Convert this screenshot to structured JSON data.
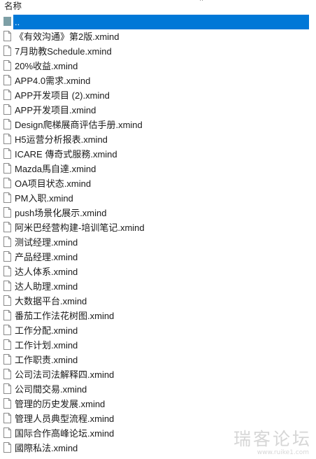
{
  "header": {
    "column_label": "名称",
    "sort_indicator": "^"
  },
  "colors": {
    "selection": "#0078d7",
    "folder_icon": "#7d9fa6",
    "file_icon_border": "#8a8a8a"
  },
  "files": [
    {
      "name": "..",
      "icon": "parent-folder-icon",
      "selected": true
    },
    {
      "name": "《有效沟通》第2版.xmind",
      "icon": "file-icon"
    },
    {
      "name": "7月助教Schedule.xmind",
      "icon": "file-icon"
    },
    {
      "name": "20%收益.xmind",
      "icon": "file-icon"
    },
    {
      "name": "APP4.0需求.xmind",
      "icon": "file-icon"
    },
    {
      "name": "APP开发项目 (2).xmind",
      "icon": "file-icon"
    },
    {
      "name": "APP开发项目.xmind",
      "icon": "file-icon"
    },
    {
      "name": "Design爬梯展商评估手册.xmind",
      "icon": "file-icon"
    },
    {
      "name": "H5运营分析报表.xmind",
      "icon": "file-icon"
    },
    {
      "name": "ICARE 傳奇式服務.xmind",
      "icon": "file-icon"
    },
    {
      "name": "Mazda馬自達.xmind",
      "icon": "file-icon"
    },
    {
      "name": "OA项目状态.xmind",
      "icon": "file-icon"
    },
    {
      "name": "PM入职.xmind",
      "icon": "file-icon"
    },
    {
      "name": "push场景化展示.xmind",
      "icon": "file-icon"
    },
    {
      "name": "阿米巴经营构建-培训笔记.xmind",
      "icon": "file-icon"
    },
    {
      "name": "测试经理.xmind",
      "icon": "file-icon"
    },
    {
      "name": "产品经理.xmind",
      "icon": "file-icon"
    },
    {
      "name": "达人体系.xmind",
      "icon": "file-icon"
    },
    {
      "name": "达人助理.xmind",
      "icon": "file-icon"
    },
    {
      "name": "大数据平台.xmind",
      "icon": "file-icon"
    },
    {
      "name": "番茄工作法花树图.xmind",
      "icon": "file-icon"
    },
    {
      "name": "工作分配.xmind",
      "icon": "file-icon"
    },
    {
      "name": "工作计划.xmind",
      "icon": "file-icon"
    },
    {
      "name": "工作职责.xmind",
      "icon": "file-icon"
    },
    {
      "name": "公司法司法解释四.xmind",
      "icon": "file-icon"
    },
    {
      "name": "公司間交易.xmind",
      "icon": "file-icon"
    },
    {
      "name": "管理的历史发展.xmind",
      "icon": "file-icon"
    },
    {
      "name": "管理人员典型流程.xmind",
      "icon": "file-icon"
    },
    {
      "name": "国际合作高峰论坛.xmind",
      "icon": "file-icon"
    },
    {
      "name": "國際私法.xmind",
      "icon": "file-icon"
    }
  ],
  "watermark": {
    "text": "瑞客论坛",
    "sub": "www.ruike1.com"
  }
}
